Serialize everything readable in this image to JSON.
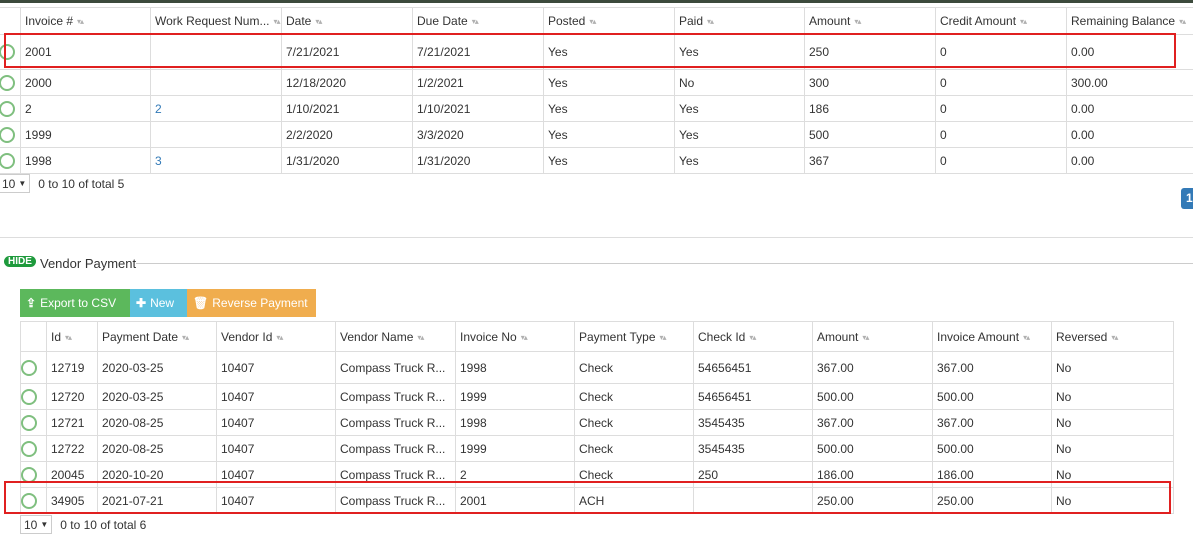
{
  "invoices": {
    "columns": [
      "Invoice #",
      "Work Request Num...",
      "Date",
      "Due Date",
      "Posted",
      "Paid",
      "Amount",
      "Credit Amount",
      "Remaining Balance"
    ],
    "rows": [
      [
        "2001",
        "",
        "7/21/2021",
        "7/21/2021",
        "Yes",
        "Yes",
        "250",
        "0",
        "0.00"
      ],
      [
        "2000",
        "",
        "12/18/2020",
        "1/2/2021",
        "Yes",
        "No",
        "300",
        "0",
        "300.00"
      ],
      [
        "2",
        "2",
        "1/10/2021",
        "1/10/2021",
        "Yes",
        "Yes",
        "186",
        "0",
        "0.00"
      ],
      [
        "1999",
        "",
        "2/2/2020",
        "3/3/2020",
        "Yes",
        "Yes",
        "500",
        "0",
        "0.00"
      ],
      [
        "1998",
        "3",
        "1/31/2020",
        "1/31/2020",
        "Yes",
        "Yes",
        "367",
        "0",
        "0.00"
      ]
    ],
    "page_size": "10",
    "summary": "0 to 10 of total 5",
    "page_number": "1"
  },
  "vendor_section": {
    "hide_badge": "HIDE",
    "title": "Vendor Payment"
  },
  "toolbar": {
    "export_label": "Export to CSV",
    "new_label": "New",
    "reverse_label": "Reverse Payment"
  },
  "payments": {
    "columns": [
      "Id",
      "Payment Date",
      "Vendor Id",
      "Vendor Name",
      "Invoice No",
      "Payment Type",
      "Check Id",
      "Amount",
      "Invoice Amount",
      "Reversed"
    ],
    "rows": [
      [
        "12719",
        "2020-03-25",
        "10407",
        "Compass Truck R...",
        "1998",
        "Check",
        "54656451",
        "367.00",
        "367.00",
        "No"
      ],
      [
        "12720",
        "2020-03-25",
        "10407",
        "Compass Truck R...",
        "1999",
        "Check",
        "54656451",
        "500.00",
        "500.00",
        "No"
      ],
      [
        "12721",
        "2020-08-25",
        "10407",
        "Compass Truck R...",
        "1998",
        "Check",
        "3545435",
        "367.00",
        "367.00",
        "No"
      ],
      [
        "12722",
        "2020-08-25",
        "10407",
        "Compass Truck R...",
        "1999",
        "Check",
        "3545435",
        "500.00",
        "500.00",
        "No"
      ],
      [
        "20045",
        "2020-10-20",
        "10407",
        "Compass Truck R...",
        "2",
        "Check",
        "250",
        "186.00",
        "186.00",
        "No"
      ],
      [
        "34905",
        "2021-07-21",
        "10407",
        "Compass Truck R...",
        "2001",
        "ACH",
        "",
        "250.00",
        "250.00",
        "No"
      ]
    ],
    "page_size": "10",
    "summary": "0 to 10 of total 6"
  },
  "colors": {
    "export_button": "#5cb85c",
    "new_button": "#5bc0de",
    "reverse_button": "#f0ad4e",
    "hide_badge": "#1e9a3c",
    "highlight": "#e02020",
    "link": "#337ab7",
    "page_active": "#337ab7"
  }
}
